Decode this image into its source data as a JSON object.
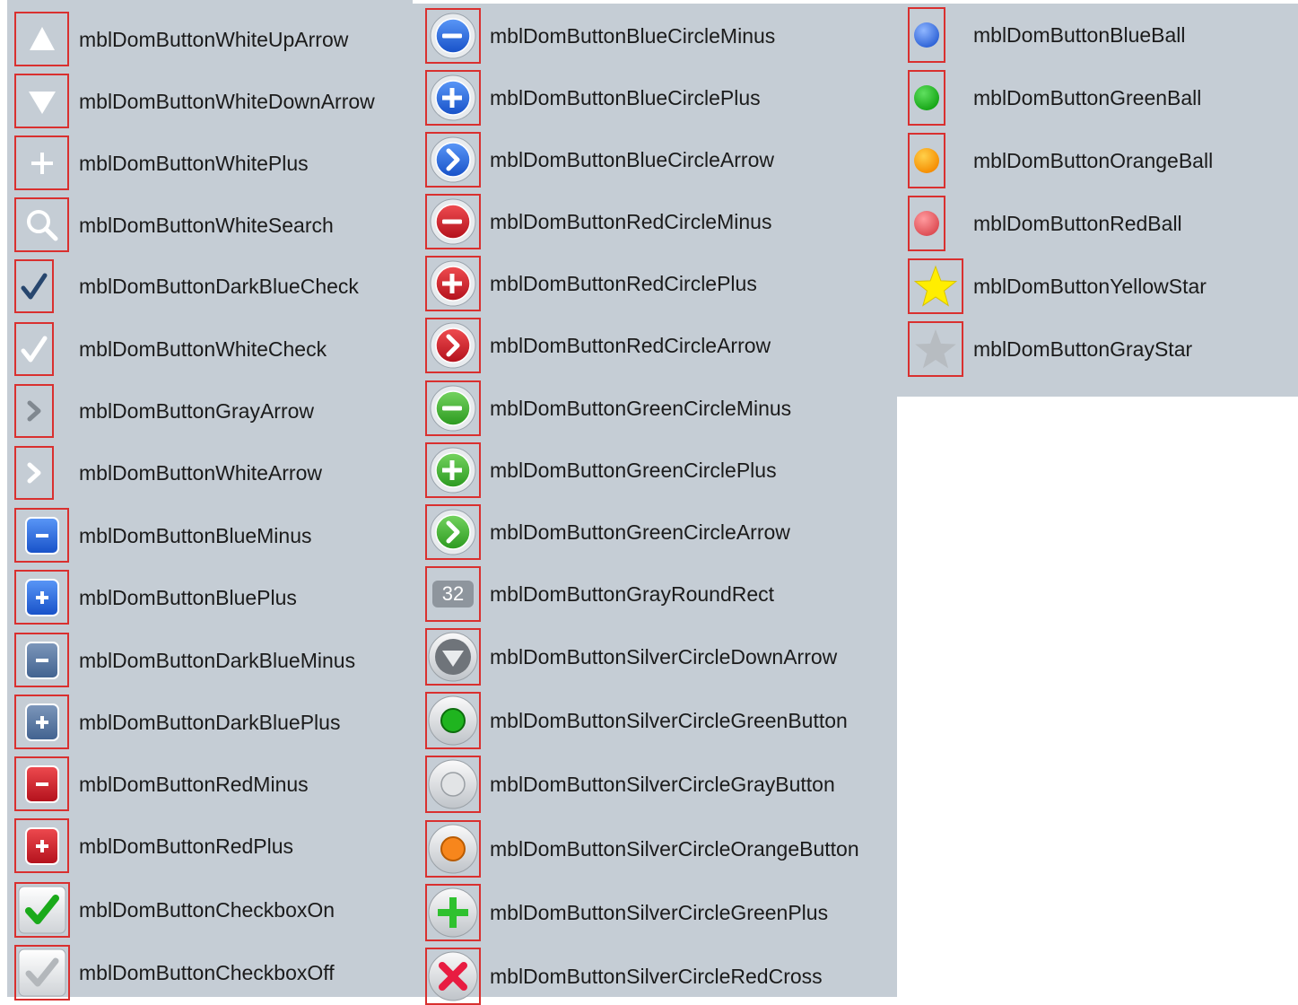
{
  "columns": [
    {
      "items": [
        {
          "label": "mblDomButtonWhiteUpArrow",
          "icon": "white-up-arrow"
        },
        {
          "label": "mblDomButtonWhiteDownArrow",
          "icon": "white-down-arrow"
        },
        {
          "label": "mblDomButtonWhitePlus",
          "icon": "white-plus"
        },
        {
          "label": "mblDomButtonWhiteSearch",
          "icon": "white-search"
        },
        {
          "label": "mblDomButtonDarkBlueCheck",
          "icon": "darkblue-check"
        },
        {
          "label": "mblDomButtonWhiteCheck",
          "icon": "white-check"
        },
        {
          "label": "mblDomButtonGrayArrow",
          "icon": "gray-arrow"
        },
        {
          "label": "mblDomButtonWhiteArrow",
          "icon": "white-arrow"
        },
        {
          "label": "mblDomButtonBlueMinus",
          "icon": "blue-minus"
        },
        {
          "label": "mblDomButtonBluePlus",
          "icon": "blue-plus"
        },
        {
          "label": "mblDomButtonDarkBlueMinus",
          "icon": "darkblue-minus"
        },
        {
          "label": "mblDomButtonDarkBluePlus",
          "icon": "darkblue-plus"
        },
        {
          "label": "mblDomButtonRedMinus",
          "icon": "red-minus"
        },
        {
          "label": "mblDomButtonRedPlus",
          "icon": "red-plus"
        },
        {
          "label": "mblDomButtonCheckboxOn",
          "icon": "checkbox-on"
        },
        {
          "label": "mblDomButtonCheckboxOff",
          "icon": "checkbox-off"
        }
      ]
    },
    {
      "items": [
        {
          "label": "mblDomButtonBlueCircleMinus",
          "icon": "blue-circle-minus"
        },
        {
          "label": "mblDomButtonBlueCirclePlus",
          "icon": "blue-circle-plus"
        },
        {
          "label": "mblDomButtonBlueCircleArrow",
          "icon": "blue-circle-arrow"
        },
        {
          "label": "mblDomButtonRedCircleMinus",
          "icon": "red-circle-minus"
        },
        {
          "label": "mblDomButtonRedCirclePlus",
          "icon": "red-circle-plus"
        },
        {
          "label": "mblDomButtonRedCircleArrow",
          "icon": "red-circle-arrow"
        },
        {
          "label": "mblDomButtonGreenCircleMinus",
          "icon": "green-circle-minus"
        },
        {
          "label": "mblDomButtonGreenCirclePlus",
          "icon": "green-circle-plus"
        },
        {
          "label": "mblDomButtonGreenCircleArrow",
          "icon": "green-circle-arrow"
        },
        {
          "label": "mblDomButtonGrayRoundRect",
          "icon": "gray-round-rect",
          "badge": "32"
        },
        {
          "label": "mblDomButtonSilverCircleDownArrow",
          "icon": "silver-circle-down-arrow"
        },
        {
          "label": "mblDomButtonSilverCircleGreenButton",
          "icon": "silver-circle-green-button"
        },
        {
          "label": "mblDomButtonSilverCircleGrayButton",
          "icon": "silver-circle-gray-button"
        },
        {
          "label": "mblDomButtonSilverCircleOrangeButton",
          "icon": "silver-circle-orange-button"
        },
        {
          "label": "mblDomButtonSilverCircleGreenPlus",
          "icon": "silver-circle-green-plus"
        },
        {
          "label": "mblDomButtonSilverCircleRedCross",
          "icon": "silver-circle-red-cross"
        }
      ]
    },
    {
      "items": [
        {
          "label": "mblDomButtonBlueBall",
          "icon": "blue-ball"
        },
        {
          "label": "mblDomButtonGreenBall",
          "icon": "green-ball"
        },
        {
          "label": "mblDomButtonOrangeBall",
          "icon": "orange-ball"
        },
        {
          "label": "mblDomButtonRedBall",
          "icon": "red-ball"
        },
        {
          "label": "mblDomButtonYellowStar",
          "icon": "yellow-star"
        },
        {
          "label": "mblDomButtonGrayStar",
          "icon": "gray-star"
        }
      ]
    }
  ],
  "colors": {
    "panel_bg": "#c5cdd5",
    "highlight_border": "#d9302f",
    "blue": "#2e73e0",
    "red": "#d3252e",
    "green": "#38b53a",
    "orange": "#ff9900",
    "yellow": "#ffee00"
  }
}
